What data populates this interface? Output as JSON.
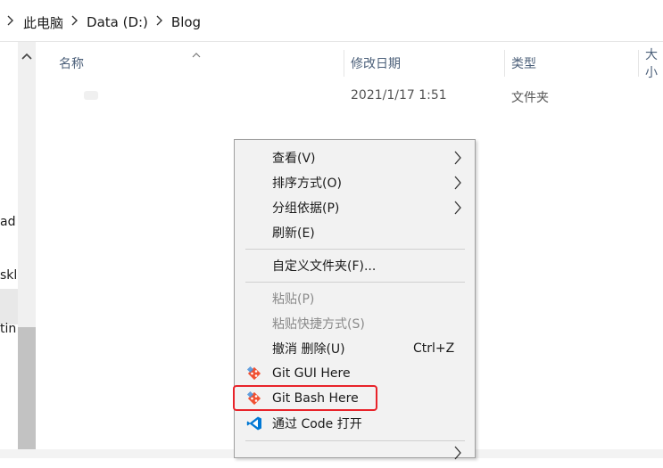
{
  "address_bar": {
    "crumbs": [
      "此电脑",
      "Data (D:)",
      "Blog"
    ]
  },
  "nav_pane": {
    "labels": [
      "ad",
      "skl",
      "tin"
    ]
  },
  "columns": {
    "name": "名称",
    "date": "修改日期",
    "type": "类型",
    "size": "大小"
  },
  "file_rows": [
    {
      "name": "",
      "date": "2021/1/17 1:51",
      "type": "文件夹"
    }
  ],
  "context_menu": {
    "items": {
      "view": "查看(V)",
      "sort": "排序方式(O)",
      "group": "分组依据(P)",
      "refresh": "刷新(E)",
      "customize": "自定义文件夹(F)...",
      "paste": "粘贴(P)",
      "paste_shortcut": "粘贴快捷方式(S)",
      "undo": "撤消 删除(U)",
      "undo_shortcut": "Ctrl+Z",
      "git_gui": "Git GUI Here",
      "git_bash": "Git Bash Here",
      "vscode": "通过 Code 打开"
    }
  },
  "colors": {
    "highlight": "#e8232a",
    "header_text": "#4c607a",
    "git": "#f05133",
    "vscode": "#0078d4"
  }
}
